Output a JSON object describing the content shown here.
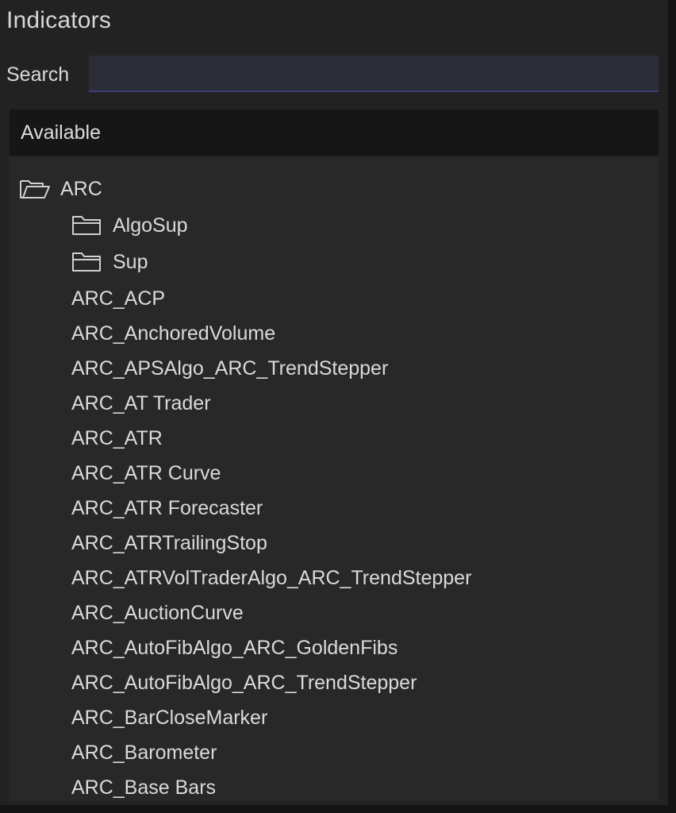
{
  "window": {
    "title": "Indicators"
  },
  "search": {
    "label": "Search",
    "value": "",
    "placeholder": ""
  },
  "available": {
    "label": "Available"
  },
  "tree": {
    "root": {
      "label": "ARC",
      "icon": "folder-open-icon"
    },
    "folders": [
      {
        "label": "AlgoSup",
        "icon": "folder-icon"
      },
      {
        "label": "Sup",
        "icon": "folder-icon"
      }
    ],
    "items": [
      "ARC_ACP",
      "ARC_AnchoredVolume",
      "ARC_APSAlgo_ARC_TrendStepper",
      "ARC_AT Trader",
      "ARC_ATR",
      "ARC_ATR Curve",
      "ARC_ATR Forecaster",
      "ARC_ATRTrailingStop",
      "ARC_ATRVolTraderAlgo_ARC_TrendStepper",
      "ARC_AuctionCurve",
      "ARC_AutoFibAlgo_ARC_GoldenFibs",
      "ARC_AutoFibAlgo_ARC_TrendStepper",
      "ARC_BarCloseMarker",
      "ARC_Barometer",
      "ARC_Base Bars"
    ]
  },
  "colors": {
    "background": "#222222",
    "text": "#dadada",
    "search_field": "#2b2d38",
    "search_underline": "#3c3f78",
    "header_bg": "#161616",
    "tree_bg": "#282828"
  }
}
